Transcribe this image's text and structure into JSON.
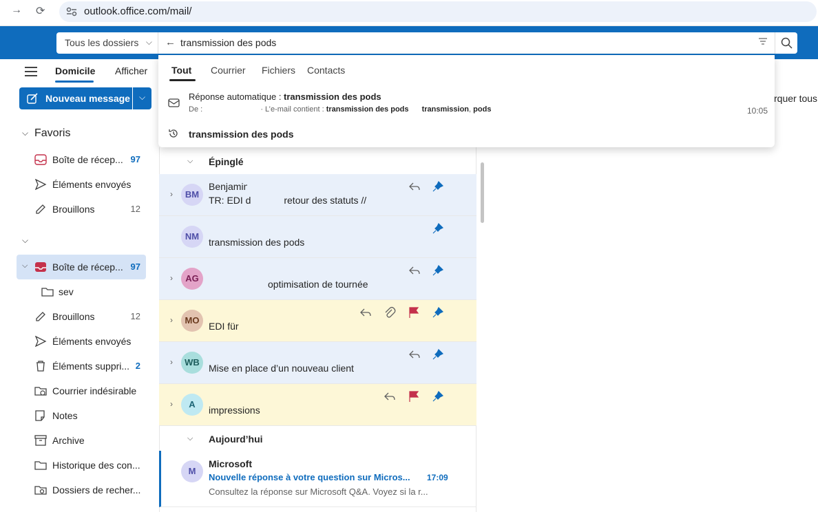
{
  "browser": {
    "url": "outlook.office.com/mail/"
  },
  "search": {
    "scope": "Tous les dossiers",
    "query": "transmission des pods"
  },
  "ribbon": {
    "tabs": [
      "Domicile",
      "Afficher"
    ],
    "new_message": "Nouveau message",
    "mark_all": "rquer tous"
  },
  "dropdown": {
    "tabs": [
      "Tout",
      "Courrier",
      "Fichiers",
      "Contacts"
    ],
    "result_title_prefix": "Réponse automatique : ",
    "result_title_bold": "transmission des pods",
    "result_meta_from": "De :",
    "result_meta_contains": "· L’e-mail contient : ",
    "result_meta_terms": [
      "transmission des pods",
      "transmission",
      "pods"
    ],
    "result_time": "10:05",
    "history_query": "transmission des pods"
  },
  "sidebar": {
    "favorites_title": "Favoris",
    "favorites": [
      {
        "label": "Boîte de récep...",
        "count": "97"
      },
      {
        "label": "Éléments envoyés",
        "count": ""
      },
      {
        "label": "Brouillons",
        "count": "12"
      }
    ],
    "account": [
      {
        "label": "Boîte de récep...",
        "count": "97"
      },
      {
        "label": "sev",
        "count": ""
      },
      {
        "label": "Brouillons",
        "count": "12"
      },
      {
        "label": "Éléments envoyés",
        "count": ""
      },
      {
        "label": "Éléments suppri...",
        "count": "2"
      },
      {
        "label": "Courrier indésirable",
        "count": ""
      },
      {
        "label": "Notes",
        "count": ""
      },
      {
        "label": "Archive",
        "count": ""
      },
      {
        "label": "Historique des con...",
        "count": ""
      },
      {
        "label": "Dossiers de recher...",
        "count": ""
      }
    ]
  },
  "mail_list": {
    "pinned_header": "Épinglé",
    "today_header": "Aujourd’hui",
    "rows": [
      {
        "initials": "BM",
        "sender": "Benjamin",
        "subject": "TR: EDI d",
        "subject_tail": "retour des statuts // ",
        "color": "#d6d6f5",
        "text": "#4f4fa8"
      },
      {
        "initials": "NM",
        "sender": "",
        "subject": "transmission des pods",
        "color": "#d6d6f5",
        "text": "#4f4fa8"
      },
      {
        "initials": "AG",
        "sender": "",
        "subject": "optimisation de tournée",
        "color": "#e3a3c8",
        "text": "#7a1f55"
      },
      {
        "initials": "MO",
        "sender": "",
        "subject": "EDI für",
        "color": "#e2c3b0",
        "text": "#6a3a1e"
      },
      {
        "initials": "WB",
        "sender": "",
        "subject": "Mise en place d’un nouveau client",
        "color": "#a9dedd",
        "text": "#1d5d5c"
      },
      {
        "initials": "A",
        "sender": "",
        "subject": "impressions",
        "color": "#bfe9f2",
        "text": "#1c6575"
      }
    ],
    "today_row": {
      "initials": "M",
      "sender": "Microsoft",
      "subject": "Nouvelle réponse à votre question sur Micros...",
      "time": "17:09",
      "preview": "Consultez la réponse sur Microsoft Q&A. Voyez si la r..."
    }
  }
}
